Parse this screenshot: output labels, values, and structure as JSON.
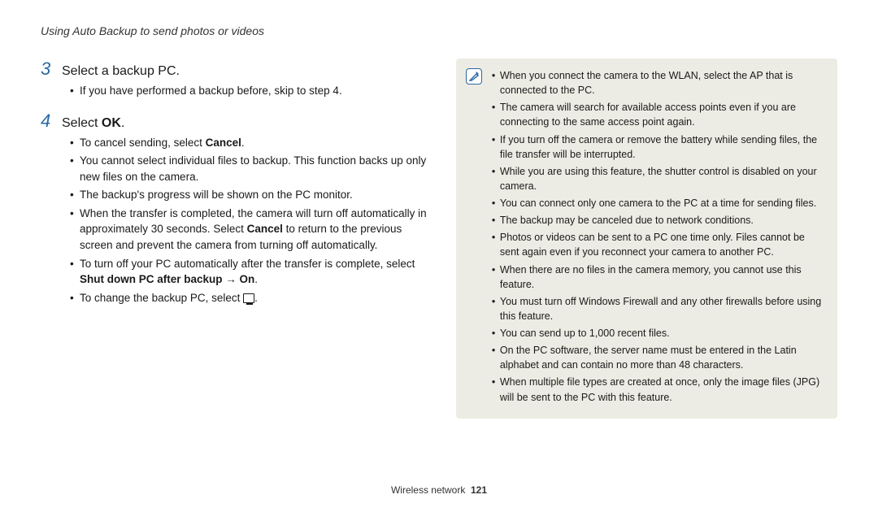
{
  "header": "Using Auto Backup to send photos or videos",
  "steps": [
    {
      "num": "3",
      "title_plain": "Select a backup PC.",
      "title_bold": "",
      "bullets": [
        {
          "pre": "If you have performed a backup before, skip to step 4.",
          "bold": "",
          "post": ""
        }
      ]
    },
    {
      "num": "4",
      "title_plain": "Select ",
      "title_bold": "OK",
      "title_post": ".",
      "bullets": [
        {
          "pre": "To cancel sending, select ",
          "bold": "Cancel",
          "post": "."
        },
        {
          "pre": "You cannot select individual files to backup. This function backs up only new files on the camera.",
          "bold": "",
          "post": ""
        },
        {
          "pre": "The backup's progress will be shown on the PC monitor.",
          "bold": "",
          "post": ""
        },
        {
          "pre": "When the transfer is completed, the camera will turn off automatically in approximately 30 seconds. Select ",
          "bold": "Cancel",
          "post": " to return to the previous screen and prevent the camera from turning off automatically."
        },
        {
          "pre": "To turn off your PC automatically after the transfer is complete, select ",
          "bold": "Shut down PC after backup → On",
          "post": "."
        },
        {
          "pre": "To change the backup PC, select ",
          "icon": true,
          "post2": "."
        }
      ]
    }
  ],
  "notes": [
    "When you connect the camera to the WLAN, select the AP that is connected to the PC.",
    "The camera will search for available access points even if you are connecting to the same access point again.",
    "If you turn off the camera or remove the battery while sending files, the file transfer will be interrupted.",
    "While you are using this feature, the shutter control is disabled on your camera.",
    "You can connect only one camera to the PC at a time for sending files.",
    "The backup may be canceled due to network conditions.",
    "Photos or videos can be sent to a PC one time only. Files cannot be sent again even if you reconnect your camera to another PC.",
    "When there are no files in the camera memory, you cannot use this feature.",
    "You must turn off Windows Firewall and any other firewalls before using this feature.",
    "You can send up to 1,000 recent files.",
    "On the PC software, the server name must be entered in the Latin alphabet and can contain no more than 48 characters.",
    "When multiple file types are created at once, only the image files (JPG) will be sent to the PC with this feature."
  ],
  "footer": {
    "section": "Wireless network",
    "page": "121"
  }
}
